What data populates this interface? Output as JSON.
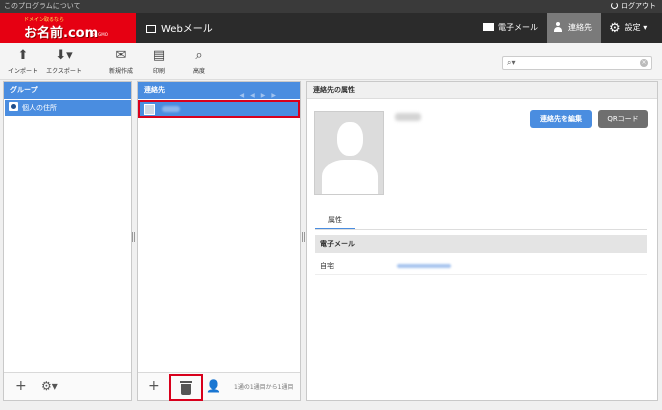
{
  "topbar": {
    "about": "このプログラムについて",
    "logout": "ログアウト"
  },
  "header": {
    "logo_tag": "ドメイン取るなら",
    "logo_main": "お名前.com",
    "logo_sub": "by GMO",
    "app": "Webメール",
    "nav": {
      "email": "電子メール",
      "contacts": "連絡先",
      "settings": "設定"
    }
  },
  "toolbar": {
    "import": "インポート",
    "export": "エクスポート",
    "new": "新規作成",
    "print": "印刷",
    "advanced": "高度"
  },
  "groups": {
    "title": "グループ",
    "items": [
      {
        "label": "個人の住所"
      }
    ]
  },
  "contacts": {
    "title": "連絡先",
    "footer_text": "1通の1通目から1通目"
  },
  "detail": {
    "title": "連絡先の属性",
    "edit_button": "連絡先を編集",
    "qr_button": "QRコード",
    "tab": "属性",
    "section": "電子メール",
    "rows": [
      {
        "label": "自宅"
      }
    ]
  },
  "colors": {
    "accent": "#4a8de0",
    "brand": "#e60012",
    "highlight": "#d8001c",
    "header_bg": "#2b2b2b"
  }
}
